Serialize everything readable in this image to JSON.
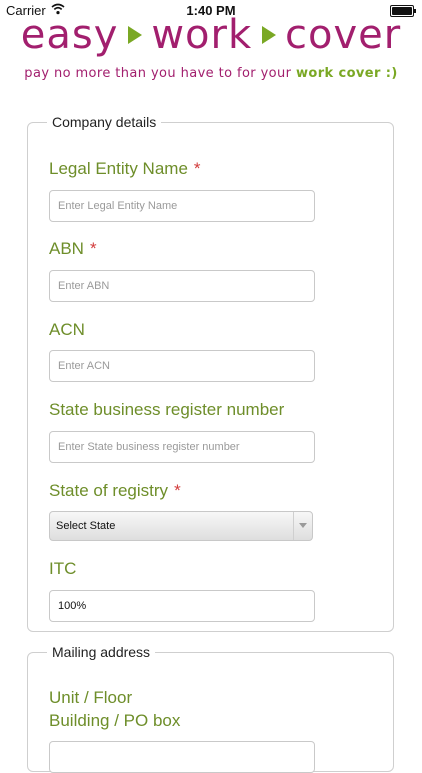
{
  "status_bar": {
    "carrier": "Carrier",
    "time": "1:40 PM"
  },
  "logo": {
    "word1": "easy",
    "word2": "work",
    "word3": "cover"
  },
  "tagline": {
    "part1": "pay no more than you have to for your ",
    "part2": "work cover :)"
  },
  "company": {
    "legend": "Company details",
    "legal_entity_label": "Legal Entity Name",
    "legal_entity_placeholder": "Enter Legal Entity Name",
    "abn_label": "ABN",
    "abn_placeholder": "Enter ABN",
    "acn_label": "ACN",
    "acn_placeholder": "Enter ACN",
    "state_reg_label": "State business register number",
    "state_reg_placeholder": "Enter State business register number",
    "state_registry_label": "State of registry",
    "state_registry_value": "Select State",
    "itc_label": "ITC",
    "itc_value": "100%",
    "required_mark": "*"
  },
  "mailing": {
    "legend": "Mailing address",
    "unit_label": "Unit / Floor",
    "building_label": "Building / PO box"
  },
  "colors": {
    "brand_purple": "#a21f6e",
    "brand_green": "#7aa824",
    "label_green": "#6e8e2a",
    "required_red": "#d23b3b"
  }
}
